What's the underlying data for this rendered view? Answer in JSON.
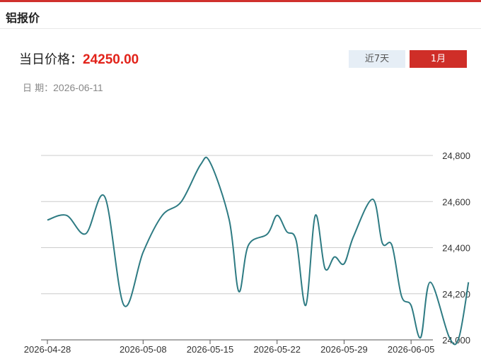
{
  "header": {
    "title": "铝报价"
  },
  "price": {
    "label": "当日价格：",
    "value": "24250.00"
  },
  "date": {
    "label": "日 期：",
    "value": "2026-06-11"
  },
  "range_buttons": {
    "week": "近7天",
    "month": "1月",
    "active": "month"
  },
  "colors": {
    "accent": "#d0312d",
    "price": "#e2231a",
    "line": "#2e7b83",
    "active_btn": "#cf2e28",
    "inactive_btn": "#e6eef6"
  },
  "chart_data": {
    "type": "line",
    "title": "",
    "xlabel": "",
    "ylabel": "",
    "x_tick_labels": [
      "2026-04-28",
      "2026-05-08",
      "2026-05-15",
      "2026-05-22",
      "2026-05-29",
      "2026-06-05"
    ],
    "y_tick_labels": [
      "24,000",
      "24,200",
      "24,400",
      "24,600",
      "24,800"
    ],
    "ylim": [
      24000,
      24800
    ],
    "grid": true,
    "y_axis_side": "right",
    "series": [
      {
        "x": [
          "2026-04-28",
          "2026-04-30",
          "2026-05-02",
          "2026-05-04",
          "2026-05-06",
          "2026-05-08",
          "2026-05-10",
          "2026-05-12",
          "2026-05-14",
          "2026-05-15",
          "2026-05-17",
          "2026-05-18",
          "2026-05-19",
          "2026-05-21",
          "2026-05-22",
          "2026-05-23",
          "2026-05-24",
          "2026-05-25",
          "2026-05-26",
          "2026-05-27",
          "2026-05-28",
          "2026-05-29",
          "2026-05-30",
          "2026-06-01",
          "2026-06-02",
          "2026-06-03",
          "2026-06-04",
          "2026-06-05",
          "2026-06-06",
          "2026-06-07",
          "2026-06-09",
          "2026-06-10",
          "2026-06-11"
        ],
        "values": [
          24520,
          24540,
          24460,
          24620,
          24150,
          24380,
          24540,
          24600,
          24760,
          24770,
          24520,
          24210,
          24410,
          24460,
          24540,
          24470,
          24430,
          24150,
          24540,
          24310,
          24360,
          24330,
          24450,
          24610,
          24420,
          24410,
          24190,
          24150,
          24010,
          24250,
          24010,
          24010,
          24250
        ]
      }
    ]
  }
}
